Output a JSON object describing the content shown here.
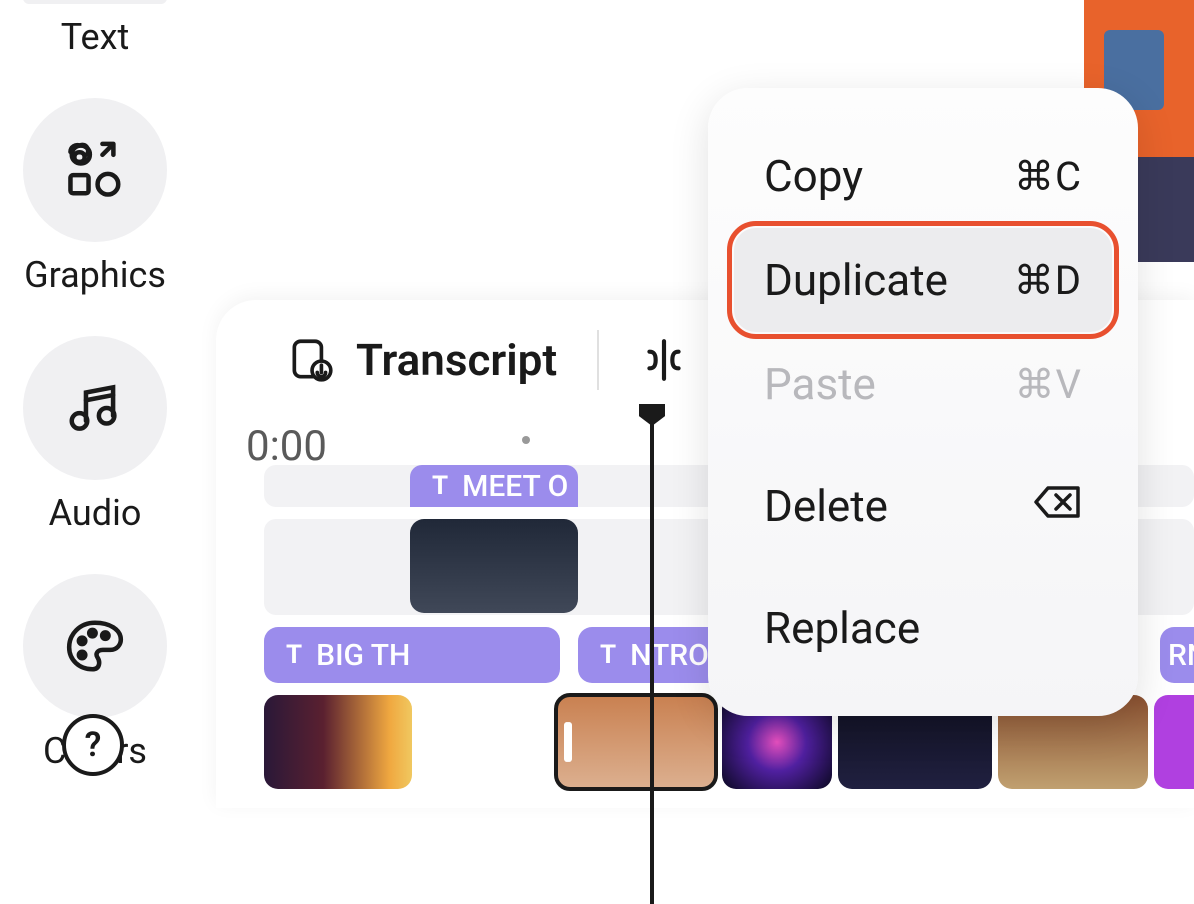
{
  "sidebar": {
    "items": [
      {
        "label": "Text"
      },
      {
        "label": "Graphics"
      },
      {
        "label": "Audio"
      },
      {
        "label": "Colors"
      }
    ]
  },
  "tabs": {
    "transcript": "Transcript"
  },
  "timeline": {
    "timestamp": "0:00",
    "text_clips": {
      "meet": "MEET O",
      "big": "BIG TH",
      "intro": "NTRO",
      "rn": "RN"
    }
  },
  "context_menu": {
    "copy": {
      "label": "Copy",
      "shortcut": "⌘C"
    },
    "duplicate": {
      "label": "Duplicate",
      "shortcut": "⌘D"
    },
    "paste": {
      "label": "Paste",
      "shortcut": "⌘V"
    },
    "delete": {
      "label": "Delete",
      "shortcut_icon": "delete"
    },
    "replace": {
      "label": "Replace"
    }
  },
  "help": "?"
}
